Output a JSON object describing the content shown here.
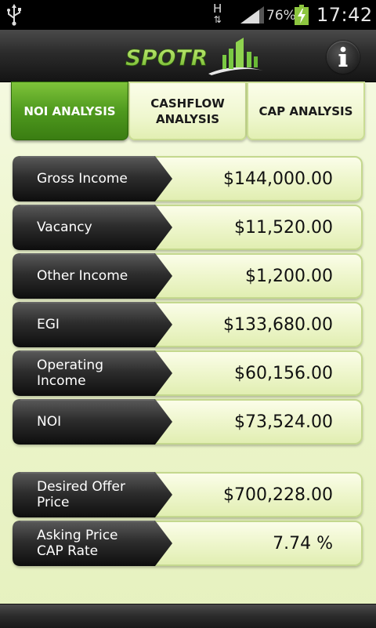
{
  "status_bar": {
    "network_type": "H",
    "battery_percent": "76%",
    "time": "17:42",
    "icons": [
      "usb-icon",
      "network-arrows-icon",
      "signal-icon",
      "battery-charging-icon"
    ]
  },
  "header": {
    "logo_text": "SPOTR",
    "info_label": "i",
    "accent_color": "#7ac943"
  },
  "tabs": [
    {
      "label": "NOI ANALYSIS",
      "active": true
    },
    {
      "label": "CASHFLOW ANALYSIS",
      "active": false
    },
    {
      "label": "CAP ANALYSIS",
      "active": false
    }
  ],
  "rows": [
    {
      "label": "Gross Income",
      "value": "$144,000.00"
    },
    {
      "label": "Vacancy",
      "value": "$11,520.00"
    },
    {
      "label": "Other Income",
      "value": "$1,200.00"
    },
    {
      "label": "EGI",
      "value": "$133,680.00"
    },
    {
      "label": "Operating Income",
      "value": "$60,156.00"
    },
    {
      "label": "NOI",
      "value": "$73,524.00"
    },
    {
      "label": "Desired Offer Price",
      "value": "$700,228.00"
    },
    {
      "label": "Asking Price CAP Rate",
      "value": "7.74 %"
    }
  ]
}
